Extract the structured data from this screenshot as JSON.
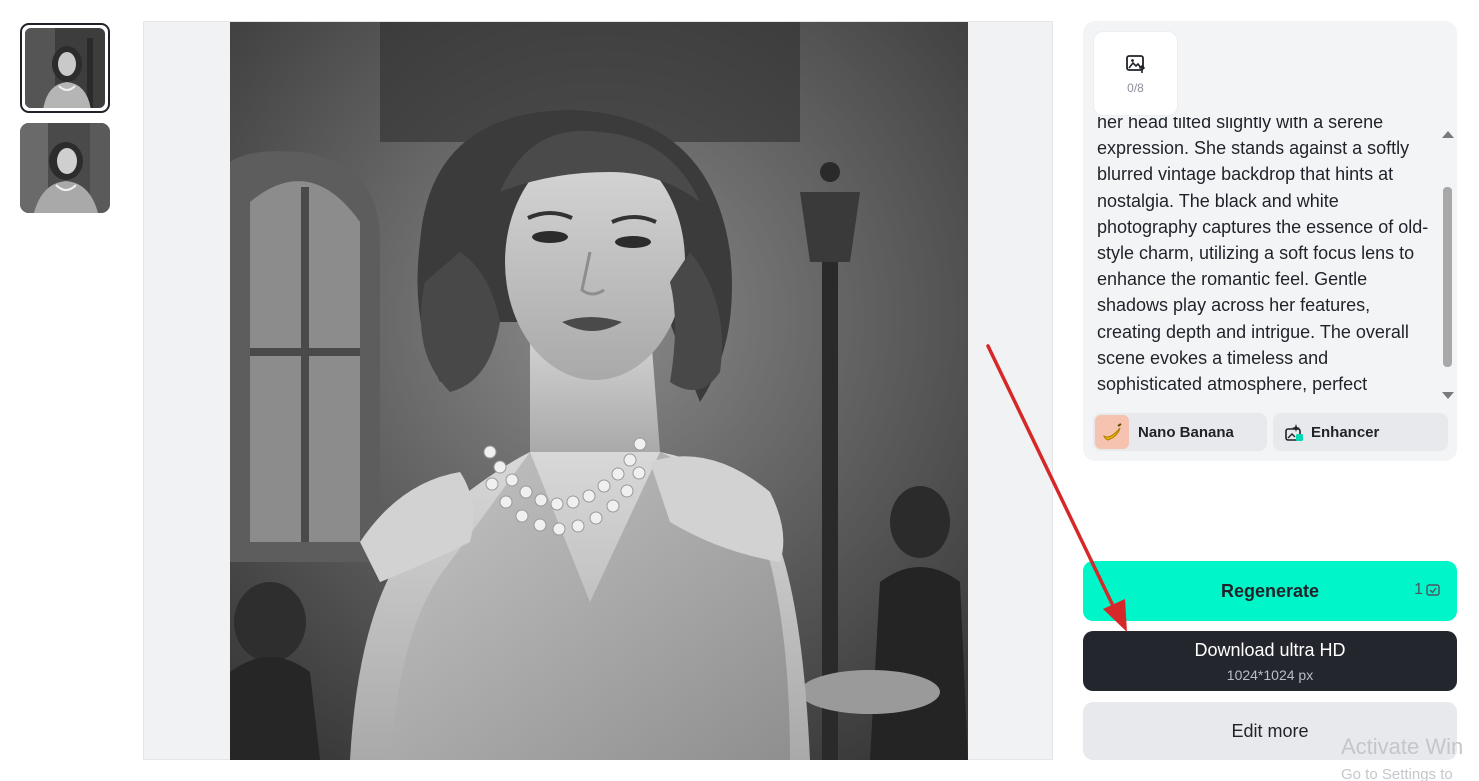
{
  "thumbnails": [
    {
      "label": "",
      "selected": true
    },
    {
      "label": "",
      "selected": false
    }
  ],
  "upload": {
    "icon": "image-upload-icon",
    "count": "0/8"
  },
  "prompt": {
    "text": "her head tilted slightly with a serene expression. She stands against a softly blurred vintage backdrop that hints at nostalgia. The black and white photography captures the essence of old-style charm, utilizing a soft focus lens to enhance the romantic feel. Gentle shadows play across her features, creating depth and intrigue. The overall scene evokes a timeless and sophisticated atmosphere, perfect"
  },
  "chips": {
    "model_label": "Nano Banana",
    "enhancer_label": "Enhancer"
  },
  "actions": {
    "regenerate_label": "Regenerate",
    "regenerate_cost": "1",
    "download_label": "Download ultra HD",
    "download_size": "1024*1024 px",
    "edit_label": "Edit more"
  },
  "system": {
    "watermark_line1": "Activate Win",
    "watermark_line2": "Go to Settings to"
  },
  "colors": {
    "accent": "#00f5c8",
    "dark_button": "#23262d",
    "annotation_arrow": "#d62828"
  }
}
